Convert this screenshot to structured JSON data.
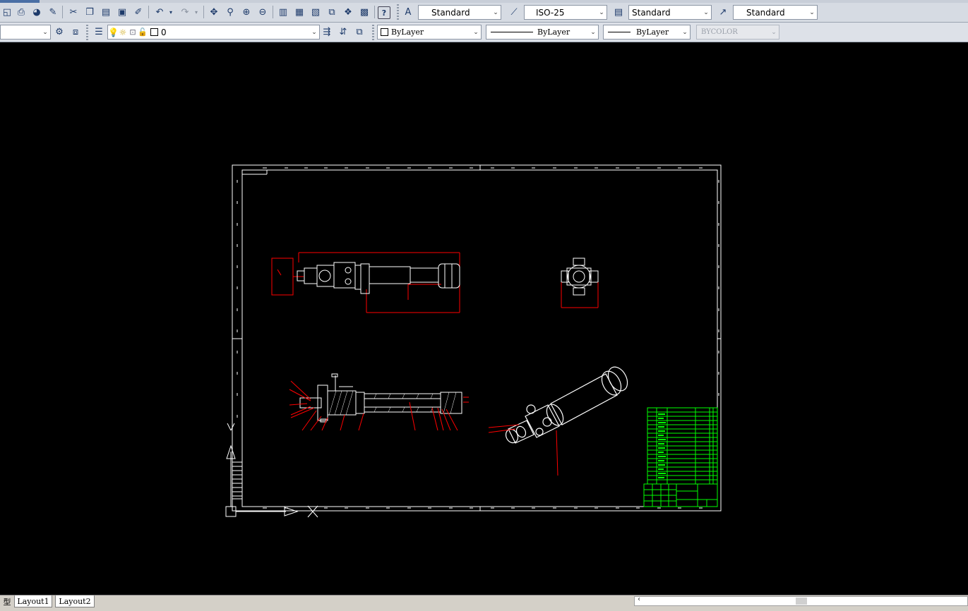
{
  "toolbar_top": {
    "text_style": "Standard",
    "dim_style": "ISO-25",
    "table_style": "Standard",
    "multileader_style": "Standard"
  },
  "toolbar_layers": {
    "current_layer": "0",
    "color": "ByLayer",
    "linetype": "ByLayer",
    "lineweight": "ByLayer",
    "plot_style": "BYCOLOR"
  },
  "layout_tabs": {
    "model": "型",
    "layout1": "Layout1",
    "layout2": "Layout2"
  },
  "colors": {
    "frame": "#ffffff",
    "dimension": "#ff0000",
    "title_block": "#00ff00",
    "background": "#000000"
  }
}
